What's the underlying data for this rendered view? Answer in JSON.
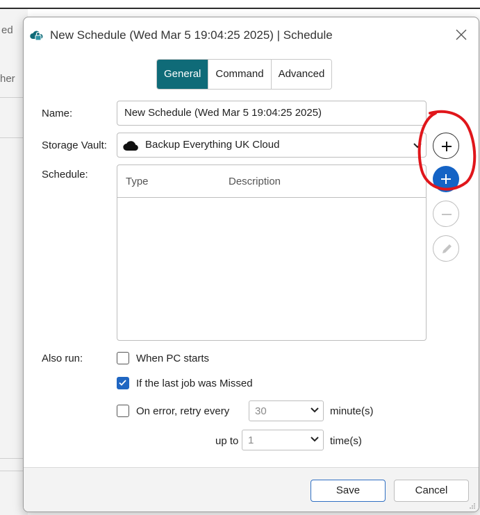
{
  "background": {
    "fragment_1": "ed",
    "fragment_2": "her"
  },
  "dialog": {
    "title": "New Schedule (Wed Mar 5 19:04:25 2025) | Schedule",
    "tabs": [
      {
        "label": "General",
        "active": true
      },
      {
        "label": "Command",
        "active": false
      },
      {
        "label": "Advanced",
        "active": false
      }
    ],
    "fields": {
      "name_label": "Name:",
      "name_value": "New Schedule (Wed Mar 5 19:04:25 2025)",
      "vault_label": "Storage Vault:",
      "vault_value": "Backup Everything UK Cloud",
      "vault_icon": "cloud-icon",
      "schedule_label": "Schedule:"
    },
    "schedule_table": {
      "columns": [
        "Type",
        "Description"
      ],
      "rows": []
    },
    "side_buttons": [
      "add-icon",
      "add-icon",
      "remove-icon",
      "edit-icon"
    ],
    "also_run": {
      "label": "Also run:",
      "when_pc_starts": {
        "label": "When PC starts",
        "checked": false
      },
      "if_last_missed": {
        "label": "If the last job was Missed",
        "checked": true
      },
      "retry": {
        "label": "On error, retry every",
        "checked": false,
        "interval_value": "30",
        "interval_unit": "minute(s)",
        "up_to_label": "up to",
        "times_value": "1",
        "times_unit": "time(s)"
      }
    },
    "footer": {
      "save_label": "Save",
      "cancel_label": "Cancel"
    },
    "colors": {
      "accent": "#0f6b78",
      "primary": "#1463c5",
      "annotation": "#e0161b"
    }
  }
}
